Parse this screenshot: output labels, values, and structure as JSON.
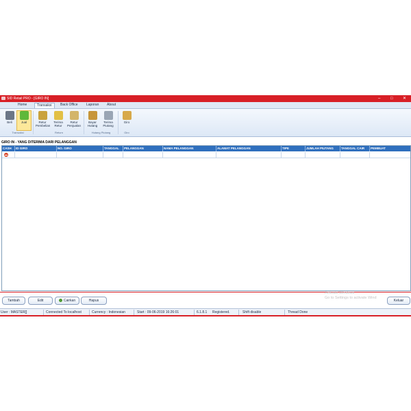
{
  "window": {
    "title": "SID Retail PRO - [GIRO IN]",
    "minimize": "–",
    "maximize": "□",
    "close": "✕"
  },
  "menu_tabs": [
    "Home",
    "Transaksi",
    "Back Office",
    "Laporan",
    "About"
  ],
  "active_tab": "Transaksi",
  "ribbon": {
    "buttons": [
      {
        "label": "Beli",
        "icon": "buy-icon"
      },
      {
        "label": "Jual",
        "icon": "sell-icon"
      },
      {
        "label": "Retur Pembelian",
        "icon": "purchase-return-icon"
      },
      {
        "label": "Terima Retur",
        "icon": "receive-return-icon"
      },
      {
        "label": "Retur Penjualan",
        "icon": "sales-return-icon"
      },
      {
        "label": "Bayar Hutang",
        "icon": "pay-debt-icon"
      },
      {
        "label": "Terima Piutang",
        "icon": "receive-receivable-icon"
      },
      {
        "label": "Giro",
        "icon": "giro-icon"
      }
    ],
    "groups": [
      "Transaksi",
      "Return",
      "Hutang Piutang",
      "Giro"
    ]
  },
  "section_title": "GIRO IN - YANG DITERIMA DARI PELANGGAN",
  "table": {
    "columns": [
      "CASH",
      "ID GIRO",
      "NO. GIRO",
      "TANGGAL",
      "PELANGGAN",
      "NAMA PELANGGAN",
      "ALAMAT PELANGGAN",
      "TIPE",
      "JUMLAH PIUTANG",
      "TANGGAL CAIR",
      "PEMBUAT"
    ]
  },
  "buttons": {
    "add": "Tambah",
    "edit": "Edit",
    "cash_out": "Cairkan",
    "delete": "Hapus",
    "exit": "Keluar"
  },
  "watermark": {
    "line1": "Activate Windows",
    "line2": "Go to Settings to activate Wind"
  },
  "status": {
    "user": "User : MASTER[]",
    "connection": "Connected To localhost",
    "currency": "Currency : Indonesian",
    "start": "Start : 09-06-2019 16:26:01",
    "version": "6.1.8.1",
    "registration": "Registered.",
    "shift": "Shift disable",
    "thread": "Thread Done"
  }
}
